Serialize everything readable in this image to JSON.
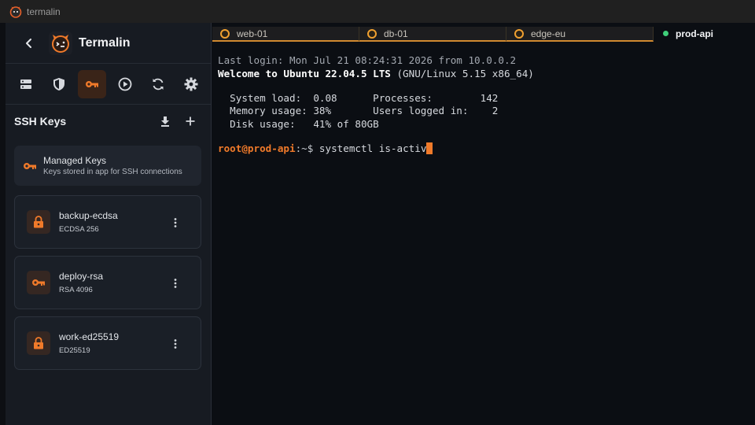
{
  "window": {
    "title": "termalin"
  },
  "sidebar": {
    "app_name": "Termalin",
    "toolbar": [
      {
        "icon": "server-icon",
        "active": false
      },
      {
        "icon": "shield-icon",
        "active": false
      },
      {
        "icon": "key-icon",
        "active": true
      },
      {
        "icon": "play-icon",
        "active": false
      },
      {
        "icon": "sync-icon",
        "active": false
      },
      {
        "icon": "gear-icon",
        "active": false
      }
    ],
    "section_title": "SSH Keys",
    "managed": {
      "title": "Managed Keys",
      "subtitle": "Keys stored in app for SSH connections"
    },
    "keys": [
      {
        "name": "backup-ecdsa",
        "type": "ECDSA 256",
        "icon": "lock-icon"
      },
      {
        "name": "deploy-rsa",
        "type": "RSA 4096",
        "icon": "key-icon"
      },
      {
        "name": "work-ed25519",
        "type": "ED25519",
        "icon": "lock-icon"
      }
    ]
  },
  "tabs": [
    {
      "label": "web-01",
      "active": false
    },
    {
      "label": "db-01",
      "active": false
    },
    {
      "label": "edge-eu",
      "active": false
    },
    {
      "label": "prod-api",
      "active": true
    }
  ],
  "terminal": {
    "last_login": "Last login: Mon Jul 21 08:24:31 2026 from 10.0.0.2",
    "welcome_bold": "Welcome to Ubuntu 22.04.5 LTS",
    "welcome_rest": " (GNU/Linux 5.15 x86_64)",
    "stats_line1": "  System load:  0.08      Processes:        142",
    "stats_line2": "  Memory usage: 38%       Users logged in:    2",
    "stats_line3": "  Disk usage:   41% of 80GB",
    "prompt_user": "root@prod-api",
    "prompt_path": ":~$ ",
    "command": "systemctl is-activ"
  },
  "colors": {
    "accent": "#f07a2a",
    "online": "#3fcf7a"
  }
}
